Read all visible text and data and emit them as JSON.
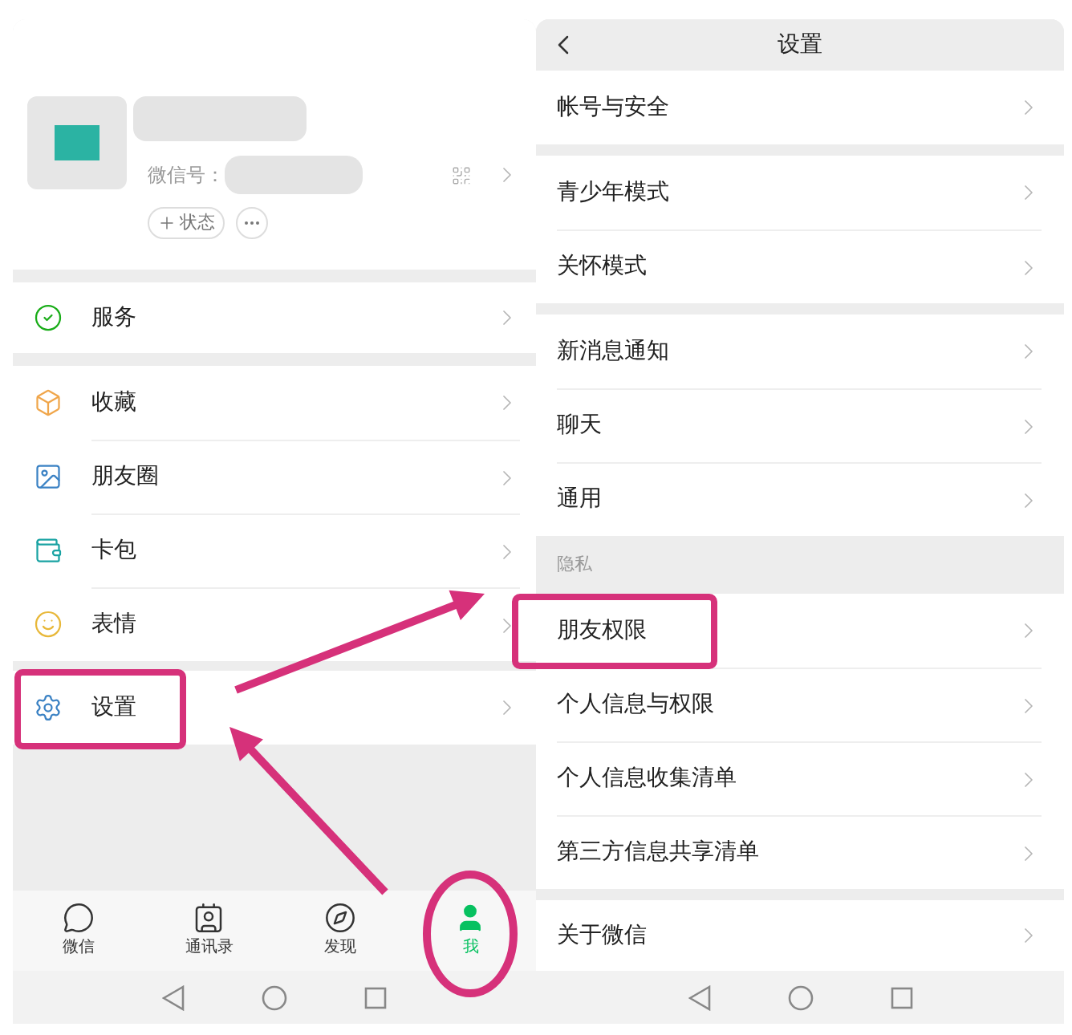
{
  "left_screen": {
    "profile": {
      "wechat_id_label": "微信号：",
      "status_button": "状态"
    },
    "menu_groups": [
      {
        "items": [
          {
            "label": "服务"
          }
        ]
      },
      {
        "items": [
          {
            "label": "收藏"
          },
          {
            "label": "朋友圈"
          },
          {
            "label": "卡包"
          },
          {
            "label": "表情"
          }
        ]
      },
      {
        "items": [
          {
            "label": "设置"
          }
        ]
      }
    ],
    "tab_bar": [
      {
        "label": "微信",
        "selected": false
      },
      {
        "label": "通讯录",
        "selected": false
      },
      {
        "label": "发现",
        "selected": false
      },
      {
        "label": "我",
        "selected": true
      }
    ]
  },
  "right_screen": {
    "title": "设置",
    "groups": [
      {
        "items": [
          {
            "label": "帐号与安全"
          }
        ]
      },
      {
        "items": [
          {
            "label": "青少年模式"
          },
          {
            "label": "关怀模式"
          }
        ]
      },
      {
        "items": [
          {
            "label": "新消息通知"
          },
          {
            "label": "聊天"
          },
          {
            "label": "通用"
          }
        ]
      },
      {
        "header": "隐私",
        "items": [
          {
            "label": "朋友权限"
          },
          {
            "label": "个人信息与权限"
          },
          {
            "label": "个人信息收集清单"
          },
          {
            "label": "第三方信息共享清单"
          }
        ]
      },
      {
        "items": [
          {
            "label": "关于微信"
          }
        ]
      }
    ]
  }
}
